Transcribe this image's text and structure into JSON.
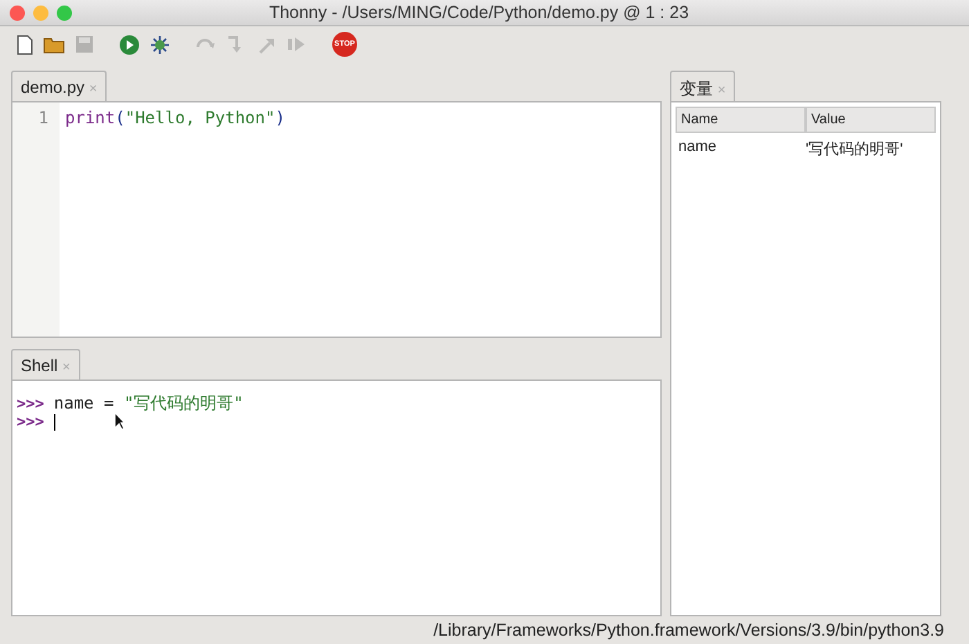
{
  "window": {
    "title": "Thonny  -  /Users/MING/Code/Python/demo.py  @  1 : 23"
  },
  "toolbar": [
    {
      "kind": "new",
      "disabled": false
    },
    {
      "kind": "open",
      "disabled": false
    },
    {
      "kind": "save",
      "disabled": true
    },
    {
      "kind": "run",
      "disabled": false
    },
    {
      "kind": "debug",
      "disabled": false
    },
    {
      "kind": "step-over",
      "disabled": true
    },
    {
      "kind": "step-into",
      "disabled": true
    },
    {
      "kind": "step-out",
      "disabled": true
    },
    {
      "kind": "resume",
      "disabled": true
    },
    {
      "kind": "stop",
      "disabled": false,
      "label": "STOP"
    }
  ],
  "editor": {
    "tab": {
      "label": "demo.py",
      "close": "×",
      "selected": true
    },
    "lines": [
      {
        "number": "1",
        "tokens": [
          {
            "kind": "builtin",
            "text": "print"
          },
          {
            "kind": "paren",
            "text": "("
          },
          {
            "kind": "string",
            "text": "\"Hello, Python\""
          },
          {
            "kind": "paren",
            "text": ")"
          }
        ]
      }
    ]
  },
  "shell": {
    "tab": {
      "label": "Shell",
      "close": "×",
      "selected": true
    },
    "lines": [
      {
        "prompt": ">>>",
        "tokens": [
          {
            "kind": "plain",
            "text": "name = "
          },
          {
            "kind": "string",
            "text": "\"写代码的明哥\""
          }
        ],
        "cursor": false
      },
      {
        "prompt": ">>>",
        "cursor": true
      }
    ]
  },
  "variables": {
    "tab": {
      "label": "变量",
      "close": "×",
      "selected": true
    },
    "columns": [
      "Name",
      "Value"
    ],
    "rows": [
      {
        "name": "name",
        "value": "'写代码的明哥'"
      }
    ]
  },
  "status_bar": "/Library/Frameworks/Python.framework/Versions/3.9/bin/python3.9"
}
